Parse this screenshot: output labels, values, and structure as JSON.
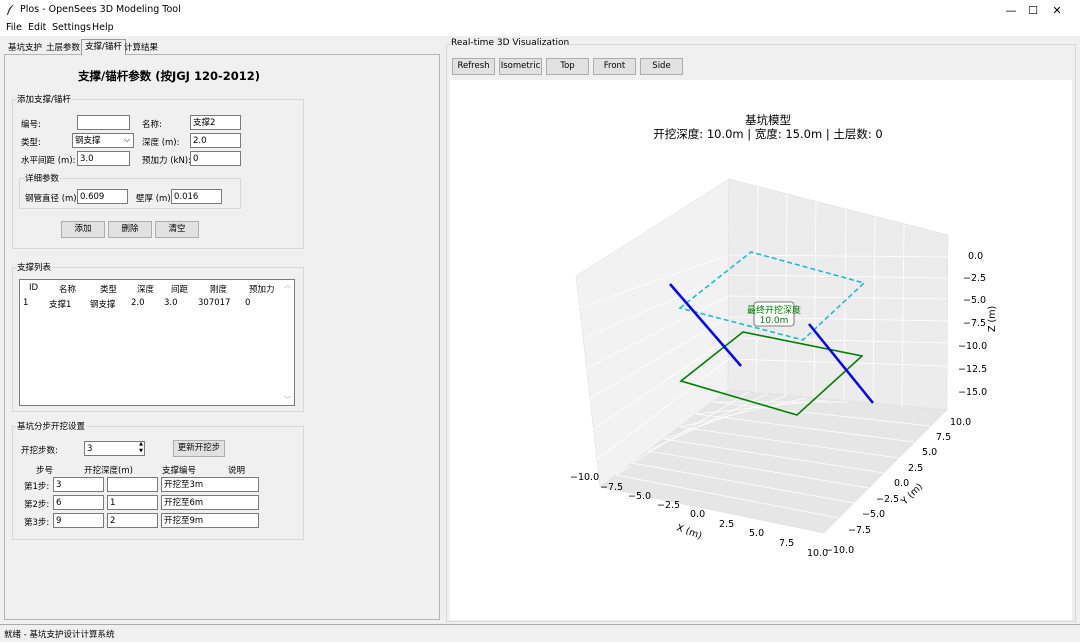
{
  "window": {
    "title": "Plos - OpenSees 3D Modeling Tool",
    "minimize": "—",
    "maximize": "☐",
    "close": "✕"
  },
  "menu": [
    "File",
    "Edit",
    "Settings",
    "Help"
  ],
  "tabs": [
    "基坑支护",
    "土层参数",
    "支撑/锚杆",
    "计算结果"
  ],
  "panel": {
    "heading": "支撑/锚杆参数 (按JGJ 120-2012)",
    "add_frame": "添加支撑/锚杆",
    "labels": {
      "id": "编号:",
      "name": "名称:",
      "type": "类型:",
      "depth": "深度 (m):",
      "spacing": "水平间距 (m):",
      "prestress": "预加力 (kN):",
      "details": "详细参数",
      "pipe_dia": "钢管直径 (m):",
      "wall": "壁厚 (m):"
    },
    "values": {
      "id": "",
      "name": "支撑2",
      "type": "钢支撑",
      "depth": "2.0",
      "spacing": "3.0",
      "prestress": "0",
      "pipe_dia": "0.609",
      "wall": "0.016"
    },
    "buttons": {
      "add": "添加",
      "delete": "删除",
      "clear": "清空"
    },
    "list_frame": "支撑列表",
    "list_headers": [
      "ID",
      "名称",
      "类型",
      "深度",
      "间距",
      "刚度",
      "预加力"
    ],
    "list_rows": [
      [
        "1",
        "支撑1",
        "钢支撑",
        "2.0",
        "3.0",
        "307017",
        "0"
      ]
    ],
    "excavation_frame": "基坑分步开挖设置",
    "steps_label": "开挖步数:",
    "steps_value": "3",
    "update_button": "更新开挖步",
    "step_headers": [
      "步号",
      "开挖深度(m)",
      "支撑编号",
      "说明"
    ],
    "steps": [
      {
        "label": "第1步:",
        "depth": "3",
        "support": "",
        "note": "开挖至3m"
      },
      {
        "label": "第2步:",
        "depth": "6",
        "support": "1",
        "note": "开挖至6m"
      },
      {
        "label": "第3步:",
        "depth": "9",
        "support": "2",
        "note": "开挖至9m"
      }
    ]
  },
  "viz": {
    "frame_title": "Real-time 3D Visualization",
    "buttons": [
      "Refresh",
      "Isometric",
      "Top",
      "Front",
      "Side"
    ],
    "title1": "基坑模型",
    "title2": "开挖深度: 10.0m | 宽度: 15.0m | 土层数: 0",
    "annotation1": "最终开挖深度",
    "annotation2": "10.0m",
    "xlabel": "X (m)",
    "ylabel": "Y (m)",
    "zlabel": "Z (m)",
    "xticks": [
      "−10.0",
      "−7.5",
      "−5.0",
      "−2.5",
      "0.0",
      "2.5",
      "5.0",
      "7.5",
      "10.0"
    ],
    "yticks": [
      "−10.0",
      "−7.5",
      "−5.0",
      "−2.5",
      "0.0",
      "2.5",
      "5.0",
      "7.5",
      "10.0"
    ],
    "zticks": [
      "0.0",
      "−2.5",
      "−5.0",
      "−7.5",
      "−10.0",
      "−12.5",
      "−15.0"
    ],
    "colors": {
      "top_outline": "#17becf",
      "bottom_outline": "#008000",
      "supports": "#0000ff"
    }
  },
  "status": "就绪 - 基坑支护设计计算系统"
}
